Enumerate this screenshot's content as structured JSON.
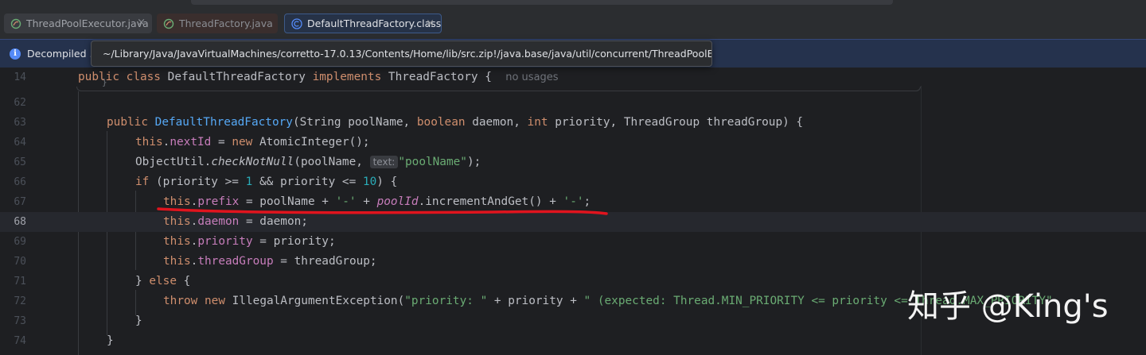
{
  "tabs": [
    {
      "label": "ThreadPoolExecutor.java",
      "close": "×"
    },
    {
      "label": "ThreadFactory.java"
    },
    {
      "label": "DefaultThreadFactory.class",
      "close": "×"
    }
  ],
  "banner": {
    "text": "Decompiled .c"
  },
  "tooltip": {
    "text": "~/Library/Java/JavaVirtualMachines/corretto-17.0.13/Contents/Home/lib/src.zip!/java.base/java/util/concurrent/ThreadPoolExecutor.java"
  },
  "editor": {
    "line_numbers": [
      "14",
      "62",
      "63",
      "64",
      "65",
      "66",
      "67",
      "68",
      "69",
      "70",
      "71",
      "72",
      "73",
      "74"
    ],
    "current_line": "68",
    "class_decl": {
      "public": "public",
      "class": "class",
      "name": "DefaultThreadFactory",
      "implements": "implements",
      "iface": "ThreadFactory",
      "brace": "{",
      "usage_hint": "no usages"
    },
    "fold_marker": "}",
    "l63": {
      "public": "public",
      "fn": "DefaultThreadFactory",
      "p1": "(String poolName, ",
      "bool": "boolean",
      "p2": " daemon, ",
      "int": "int",
      "p3": " priority, ThreadGroup threadGroup) {"
    },
    "l64": {
      "this": "this",
      "dot": ".",
      "fld": "nextId",
      "mid": " = ",
      "new": "new",
      "rest": " AtomicInteger();"
    },
    "l65": {
      "a": "ObjectUtil.",
      "fn": "checkNotNull",
      "b": "(poolName, ",
      "hint": "text:",
      "str": "\"poolName\"",
      "c": ");"
    },
    "l66": {
      "if": "if",
      "a": " (priority >= ",
      "n1": "1",
      "b": " && priority <= ",
      "n2": "10",
      "c": ") {"
    },
    "l67": {
      "this": "this",
      "dot": ".",
      "fld": "prefix",
      "a": " = poolName + ",
      "s1": "'-'",
      "b": " + ",
      "st": "poolId",
      "c": ".incrementAndGet() + ",
      "s2": "'-'",
      "d": ";"
    },
    "l68": {
      "this": "this",
      "dot": ".",
      "fld": "daemon",
      "a": " = daemon;"
    },
    "l69": {
      "this": "this",
      "dot": ".",
      "fld": "priority",
      "a": " = priority;"
    },
    "l70": {
      "this": "this",
      "dot": ".",
      "fld": "threadGroup",
      "a": " = threadGroup;"
    },
    "l71": {
      "a": "} ",
      "else": "else",
      "b": " {"
    },
    "l72": {
      "throw": "throw",
      "sp": " ",
      "new": "new",
      "a": " IllegalArgumentException(",
      "s1": "\"priority: \"",
      "b": " + priority + ",
      "s2": "\" (expected: Thread.MIN_PRIORITY <= priority <= Thread.MAX_PRIORITY\""
    },
    "l73": {
      "a": "}"
    },
    "l74": {
      "a": "}"
    }
  },
  "watermark": {
    "text": "知乎 @King's"
  },
  "colors": {
    "keyword": "#cf8e6d",
    "function": "#56a8f5",
    "field": "#c77dbb",
    "number": "#2aacb8",
    "string": "#6aab73",
    "annotation_line": "#e0141e"
  }
}
